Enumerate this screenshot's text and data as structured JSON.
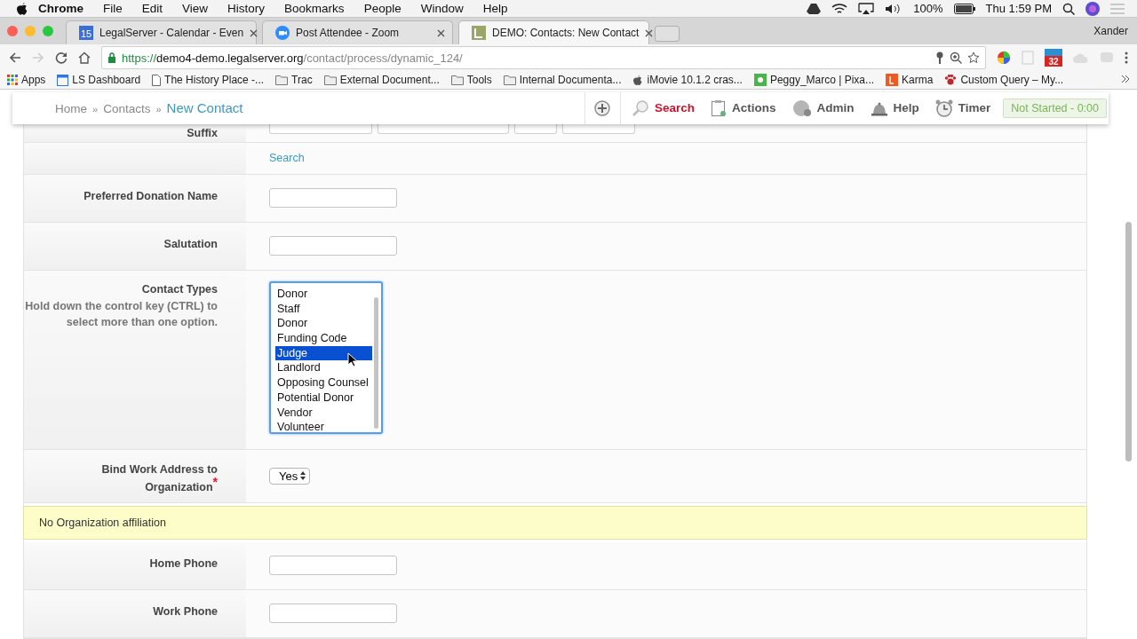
{
  "menubar": {
    "app": "Chrome",
    "menus": [
      "File",
      "Edit",
      "View",
      "History",
      "Bookmarks",
      "People",
      "Window",
      "Help"
    ],
    "battery": "100%",
    "clock": "Thu 1:59 PM"
  },
  "tabs": [
    {
      "title": "LegalServer - Calendar - Even",
      "kind": "calendar",
      "badge": "15",
      "selected": false
    },
    {
      "title": "Post Attendee - Zoom",
      "kind": "zoom",
      "selected": false
    },
    {
      "title": "DEMO: Contacts: New Contact",
      "kind": "legalserver",
      "selected": true
    }
  ],
  "profile": "Xander",
  "address": {
    "scheme": "https://",
    "host": "demo4-demo.legalserver.org",
    "path": "/contact/process/dynamic_124/"
  },
  "extension_badge": "32",
  "bookmarks": [
    {
      "label": "Apps",
      "kind": "apps"
    },
    {
      "label": "LS Dashboard",
      "kind": "window"
    },
    {
      "label": "The History Place -...",
      "kind": "page"
    },
    {
      "label": "Trac",
      "kind": "folder"
    },
    {
      "label": "External Document...",
      "kind": "folder"
    },
    {
      "label": "Tools",
      "kind": "folder"
    },
    {
      "label": "Internal Documenta...",
      "kind": "folder"
    },
    {
      "label": "iMovie 10.1.2 cras...",
      "kind": "apple"
    },
    {
      "label": "Peggy_Marco | Pixa...",
      "kind": "pixabay"
    },
    {
      "label": "Karma",
      "kind": "karma"
    },
    {
      "label": "Custom Query – My...",
      "kind": "paw"
    }
  ],
  "breadcrumbs": [
    {
      "label": "Home",
      "current": false
    },
    {
      "separator": "»",
      "label": "Contacts",
      "current": false
    },
    {
      "separator": "»",
      "label": "New Contact",
      "current": true
    }
  ],
  "nav": [
    {
      "label": "Search",
      "kind": "search",
      "selected": true
    },
    {
      "label": "Actions",
      "kind": "clipboard",
      "selected": false
    },
    {
      "label": "Admin",
      "kind": "globe",
      "selected": false
    },
    {
      "label": "Help",
      "kind": "bell",
      "selected": false
    },
    {
      "label": "Timer",
      "kind": "clock",
      "selected": false
    }
  ],
  "timer": "Not Started - 0:00",
  "form": {
    "rows": [
      {
        "kind": "partial",
        "label": "Suffix"
      },
      {
        "kind": "link",
        "link": "Search"
      },
      {
        "kind": "text",
        "label": "Preferred Donation Name"
      },
      {
        "kind": "text",
        "label": "Salutation"
      },
      {
        "kind": "multiselect",
        "label": "Contact Types",
        "hint": "Hold down the control key (CTRL) to",
        "hint2": "select more than one option.",
        "options": [
          {
            "label": "Donor",
            "selected": false
          },
          {
            "label": "Staff",
            "selected": false
          },
          {
            "label": "Donor",
            "selected": false
          },
          {
            "label": "Funding Code",
            "selected": false
          },
          {
            "label": "Judge",
            "selected": true
          },
          {
            "label": "Landlord",
            "selected": false
          },
          {
            "label": "Opposing Counsel",
            "selected": false
          },
          {
            "label": "Potential Donor",
            "selected": false
          },
          {
            "label": "Vendor",
            "selected": false
          },
          {
            "label": "Volunteer",
            "selected": false
          }
        ]
      },
      {
        "kind": "select",
        "label": "Bind Work Address to",
        "label2": "Organization",
        "required_mark": "*",
        "value": "Yes"
      },
      {
        "kind": "notice",
        "text": "No Organization affiliation"
      },
      {
        "kind": "text",
        "label": "Home Phone"
      },
      {
        "kind": "text",
        "label": "Work Phone"
      }
    ]
  }
}
